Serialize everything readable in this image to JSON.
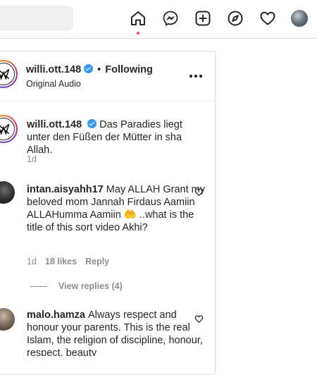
{
  "topnav": {
    "icons": [
      "home-icon",
      "messenger-icon",
      "new-post-icon",
      "explore-icon",
      "activity-heart-icon"
    ],
    "accent": "#ed4956"
  },
  "post": {
    "author": "willi.ott.148",
    "separator": "•",
    "follow_status": "Following",
    "audio": "Original Audio",
    "verified_color": "#3897f0"
  },
  "caption": {
    "username": "willi.ott.148",
    "text": "Das Paradies liegt unter den Füßen der Mütter in sha Allah.",
    "time": "1d"
  },
  "comments": [
    {
      "username": "intan.aisyahh17",
      "text": "May ALLAH Grant my beloved mom Jannah Firdaus Aamiin ALLAHumma Aamiin 🤲 ..what is the title of this sort video Akhi?",
      "time": "1d",
      "likes": "18 likes",
      "reply": "Reply",
      "view_replies": "View replies (4)"
    },
    {
      "username": "malo.hamza",
      "text": "Always respect and honour your parents. This is the real Islam, the religion of discipline, honour, respect, beauty"
    }
  ]
}
